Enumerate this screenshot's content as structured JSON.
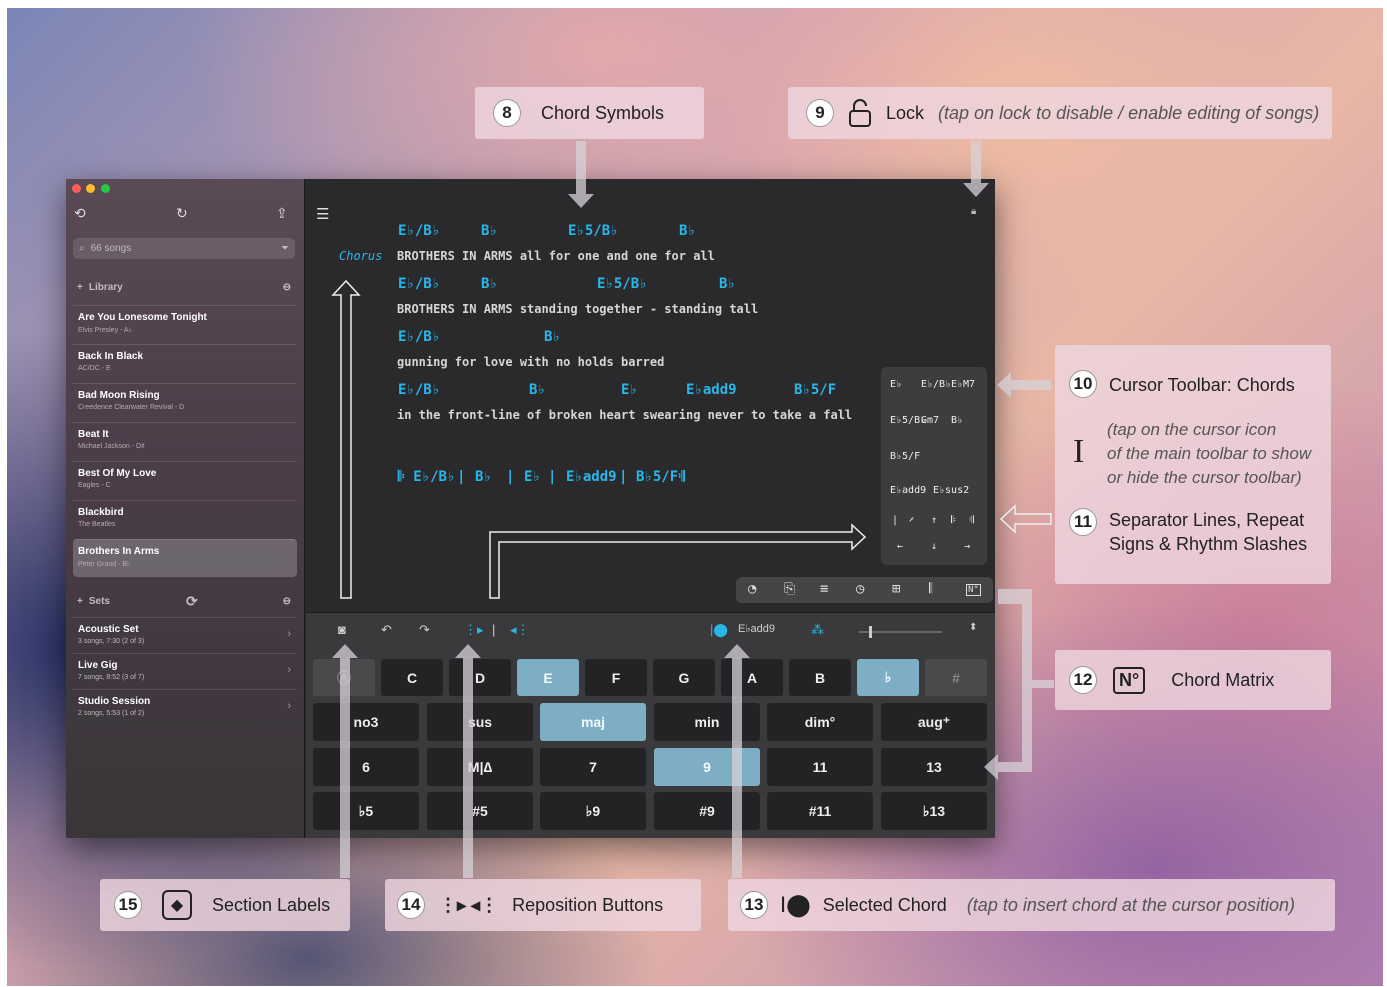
{
  "callouts": {
    "c8": {
      "num": "8",
      "label": "Chord Symbols"
    },
    "c9": {
      "num": "9",
      "label": "Lock",
      "hint": "(tap on lock to disable / enable editing of songs)"
    },
    "c10": {
      "num": "10",
      "label": "Cursor Toolbar: Chords",
      "hint1": "(tap on the cursor icon",
      "hint2": "of the main toolbar to show",
      "hint3": "or hide the cursor toolbar)"
    },
    "c11": {
      "num": "11",
      "label1": "Separator Lines, Repeat",
      "label2": "Signs & Rhythm Slashes"
    },
    "c12": {
      "num": "12",
      "icon": "N°",
      "label": "Chord Matrix"
    },
    "c13": {
      "num": "13",
      "label": "Selected Chord",
      "hint": "(tap to insert chord at the cursor position)"
    },
    "c14": {
      "num": "14",
      "label": "Reposition Buttons"
    },
    "c15": {
      "num": "15",
      "label": "Section Labels"
    }
  },
  "sidebar": {
    "search_placeholder": "66 songs",
    "library_label": "Library",
    "songs": [
      {
        "title": "Are You Lonesome Tonight",
        "meta": "Elvis Presley - A♭"
      },
      {
        "title": "Back In Black",
        "meta": "AC/DC - E"
      },
      {
        "title": "Bad Moon Rising",
        "meta": "Creedence Clearwater Revival - D"
      },
      {
        "title": "Beat It",
        "meta": "Michael Jackson - D♯"
      },
      {
        "title": "Best Of My Love",
        "meta": "Eagles - C"
      },
      {
        "title": "Blackbird",
        "meta": "The Beatles"
      },
      {
        "title": "Brothers In Arms",
        "meta": "Peter Grand - B♭"
      }
    ],
    "sets_label": "Sets",
    "sets": [
      {
        "title": "Acoustic Set",
        "meta": "3 songs, 7:30 (2 of 3)"
      },
      {
        "title": "Live Gig",
        "meta": "7 songs, 8:52 (3 of 7)"
      },
      {
        "title": "Studio Session",
        "meta": "2 songs, 5:53 (1 of 2)"
      }
    ]
  },
  "editor": {
    "section_label": "Chorus",
    "lyrics": [
      "BROTHERS IN ARMS all for one and one for all",
      "BROTHERS IN ARMS standing together - standing tall",
      "gunning for love with no holds barred",
      "in the front-line of broken heart swearing never to take a fall"
    ],
    "chords": {
      "l1": [
        "E♭/B♭",
        "B♭",
        "E♭5/B♭",
        "B♭"
      ],
      "l2": [
        "E♭/B♭",
        "B♭",
        "E♭5/B♭",
        "B♭"
      ],
      "l3": [
        "E♭/B♭",
        "B♭"
      ],
      "l4": [
        "E♭/B♭",
        "B♭",
        "E♭",
        "E♭add9",
        "B♭5/F"
      ],
      "bar": [
        "𝄆 E♭/B♭",
        "|",
        "B♭",
        "|",
        "E♭",
        "|",
        "E♭add9",
        "|",
        "B♭5/F",
        "𝄇"
      ]
    },
    "cursor_toolbar": [
      "E♭",
      "E♭/B♭",
      "E♭M7",
      "E♭5/B♭",
      "Gm7",
      "B♭",
      "B♭5/F",
      "E♭add9",
      "E♭sus2",
      "|",
      "𝄎",
      "↑",
      "𝄆",
      "𝄇",
      "←",
      "↓",
      "→"
    ]
  },
  "keyboard": {
    "selected_chord": "E♭add9",
    "roots": [
      "C",
      "D",
      "E",
      "F",
      "G",
      "A",
      "B",
      "♭",
      "#"
    ],
    "qualities": [
      "no3",
      "sus",
      "maj",
      "min",
      "dim°",
      "aug⁺"
    ],
    "ext1": [
      "6",
      "M|∆",
      "7",
      "9",
      "11",
      "13"
    ],
    "ext2": [
      "♭5",
      "#5",
      "♭9",
      "#9",
      "#11",
      "♭13"
    ]
  },
  "colors": {
    "chord": "#29b6e8",
    "key_on": "#7eaec4"
  }
}
